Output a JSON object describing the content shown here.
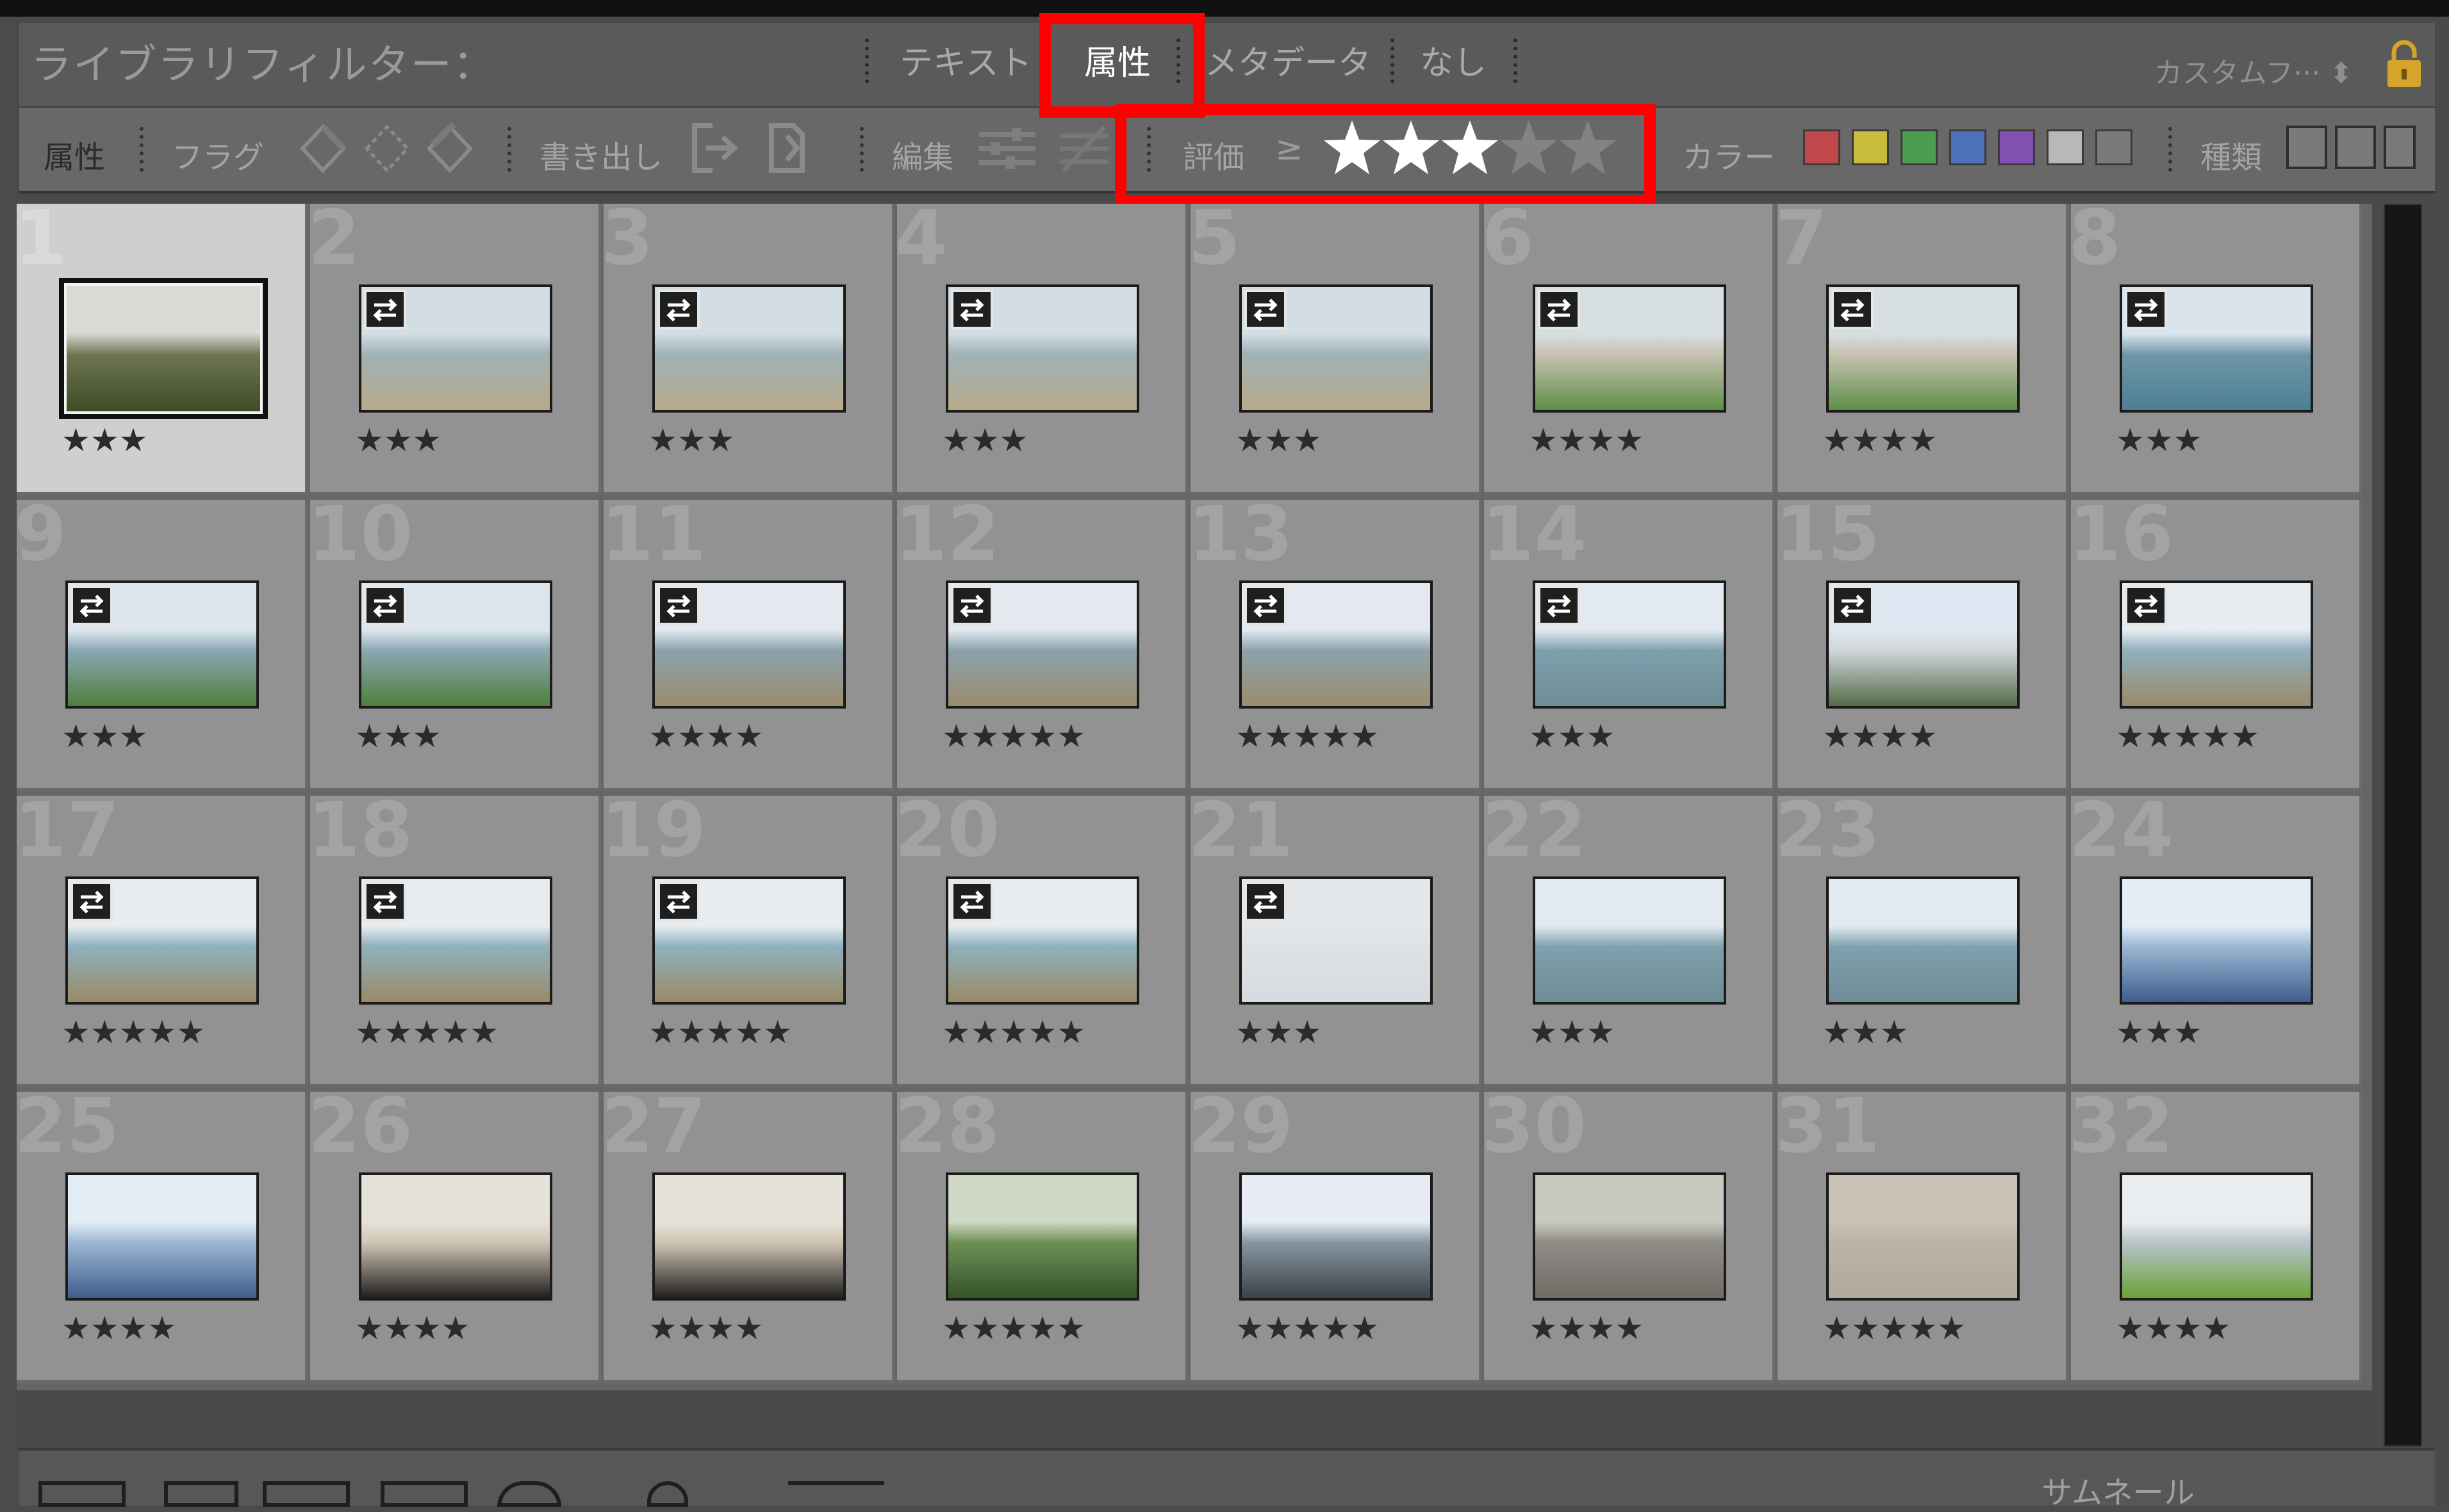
{
  "header": {
    "title": "ライブラリフィルター：",
    "tabs": [
      {
        "label": "テキスト",
        "active": false
      },
      {
        "label": "属性",
        "active": true
      },
      {
        "label": "メタデータ",
        "active": false
      },
      {
        "label": "なし",
        "active": false
      }
    ],
    "custom_preset": "カスタムフ··· ⬍",
    "lock_icon": "lock-icon"
  },
  "filter_bar": {
    "section_label": "属性",
    "flag_label": "フラグ",
    "edit_label": "書き出し",
    "edit2_label": "編集",
    "rating_label": "評価",
    "rating_operator": "≥",
    "rating_value": 3,
    "rating_max": 5,
    "color_label": "カラー",
    "colors": [
      "#c0474a",
      "#c9bc3c",
      "#4c9c52",
      "#4f71b8",
      "#8150b0",
      "#b8b8b8",
      "#7a7a7a"
    ],
    "kind_label": "種類"
  },
  "grid": [
    {
      "num": "1",
      "stars": "★★★",
      "rating": 3,
      "selected": true,
      "vc": false,
      "scene": "pinecone"
    },
    {
      "num": "2",
      "stars": "★★★",
      "rating": 3,
      "vc": true,
      "scene": "beach"
    },
    {
      "num": "3",
      "stars": "★★★",
      "rating": 3,
      "vc": true,
      "scene": "beach"
    },
    {
      "num": "4",
      "stars": "★★★",
      "rating": 3,
      "vc": true,
      "scene": "beach"
    },
    {
      "num": "5",
      "stars": "★★★",
      "rating": 3,
      "vc": true,
      "scene": "beach"
    },
    {
      "num": "6",
      "stars": "★★★★",
      "rating": 4,
      "vc": true,
      "scene": "greenbeach"
    },
    {
      "num": "7",
      "stars": "★★★★",
      "rating": 4,
      "vc": true,
      "scene": "greenbeach"
    },
    {
      "num": "8",
      "stars": "★★★",
      "rating": 3,
      "vc": true,
      "scene": "pier"
    },
    {
      "num": "9",
      "stars": "★★★",
      "rating": 3,
      "vc": true,
      "scene": "coast"
    },
    {
      "num": "10",
      "stars": "★★★",
      "rating": 3,
      "vc": true,
      "scene": "coast"
    },
    {
      "num": "11",
      "stars": "★★★★",
      "rating": 4,
      "vc": true,
      "scene": "rocks"
    },
    {
      "num": "12",
      "stars": "★★★★★",
      "rating": 5,
      "vc": true,
      "scene": "rocks"
    },
    {
      "num": "13",
      "stars": "★★★★★",
      "rating": 5,
      "vc": true,
      "scene": "rocks"
    },
    {
      "num": "14",
      "stars": "★★★",
      "rating": 3,
      "vc": true,
      "scene": "sea"
    },
    {
      "num": "15",
      "stars": "★★★★",
      "rating": 4,
      "vc": true,
      "scene": "town"
    },
    {
      "num": "16",
      "stars": "★★★★★",
      "rating": 5,
      "vc": true,
      "scene": "seawall"
    },
    {
      "num": "17",
      "stars": "★★★★★",
      "rating": 5,
      "vc": true,
      "scene": "seawall"
    },
    {
      "num": "18",
      "stars": "★★★★★",
      "rating": 5,
      "vc": true,
      "scene": "seawall"
    },
    {
      "num": "19",
      "stars": "★★★★★",
      "rating": 5,
      "vc": true,
      "scene": "seawall"
    },
    {
      "num": "20",
      "stars": "★★★★★",
      "rating": 5,
      "vc": true,
      "scene": "seawall"
    },
    {
      "num": "21",
      "stars": "★★★",
      "rating": 3,
      "vc": true,
      "scene": "sky"
    },
    {
      "num": "22",
      "stars": "★★★",
      "rating": 3,
      "vc": false,
      "scene": "sea"
    },
    {
      "num": "23",
      "stars": "★★★",
      "rating": 3,
      "vc": false,
      "scene": "sea"
    },
    {
      "num": "24",
      "stars": "★★★",
      "rating": 3,
      "vc": false,
      "scene": "sign"
    },
    {
      "num": "25",
      "stars": "★★★★",
      "rating": 4,
      "vc": false,
      "scene": "sign"
    },
    {
      "num": "26",
      "stars": "★★★★",
      "rating": 4,
      "vc": false,
      "scene": "cat"
    },
    {
      "num": "27",
      "stars": "★★★★",
      "rating": 4,
      "vc": false,
      "scene": "cat"
    },
    {
      "num": "28",
      "stars": "★★★★★",
      "rating": 5,
      "vc": false,
      "scene": "garden"
    },
    {
      "num": "29",
      "stars": "★★★★★",
      "rating": 5,
      "vc": false,
      "scene": "street"
    },
    {
      "num": "30",
      "stars": "★★★★",
      "rating": 4,
      "vc": false,
      "scene": "road"
    },
    {
      "num": "31",
      "stars": "★★★★★",
      "rating": 5,
      "vc": false,
      "scene": "sand"
    },
    {
      "num": "32",
      "stars": "★★★★",
      "rating": 4,
      "vc": false,
      "scene": "icecream"
    }
  ],
  "scene_colors": {
    "pinecone": [
      "#d7dbd4",
      "#6d7451",
      "#3d4a23"
    ],
    "beach": [
      "#d2dde4",
      "#9fb2b6",
      "#b9a98a"
    ],
    "greenbeach": [
      "#d7dee0",
      "#c7c2b2",
      "#5e8f45"
    ],
    "pier": [
      "#d9e4ec",
      "#6f96a7",
      "#4d7f93"
    ],
    "coast": [
      "#dde6ee",
      "#8aa7b3",
      "#4f7f3c"
    ],
    "rocks": [
      "#e3e9ef",
      "#8ca2ac",
      "#9c8c6f"
    ],
    "sea": [
      "#e2e9f0",
      "#7fa0ae",
      "#6e8c95"
    ],
    "town": [
      "#dfe8f2",
      "#cfd5d8",
      "#546c49"
    ],
    "seawall": [
      "#e7ecf0",
      "#8fb0bd",
      "#9a8a67"
    ],
    "sky": [
      "#e3e7ea",
      "#dde2e6",
      "#d5dbe0"
    ],
    "sign": [
      "#e2edf5",
      "#9bb7d3",
      "#3f5d8c"
    ],
    "cat": [
      "#e6e1d9",
      "#d0c4b3",
      "#1f1f1f"
    ],
    "garden": [
      "#cfd8c4",
      "#6d8f55",
      "#35542a"
    ],
    "street": [
      "#e6ecf2",
      "#8596a2",
      "#3d4247"
    ],
    "road": [
      "#c7cabf",
      "#8f8d86",
      "#6f6d66"
    ],
    "sand": [
      "#c9c2b6",
      "#bcb4a6",
      "#b0a898"
    ],
    "icecream": [
      "#e9edef",
      "#b7c4c8",
      "#6aa13b"
    ]
  },
  "bottom": {
    "thumb_label": "サムネール"
  }
}
